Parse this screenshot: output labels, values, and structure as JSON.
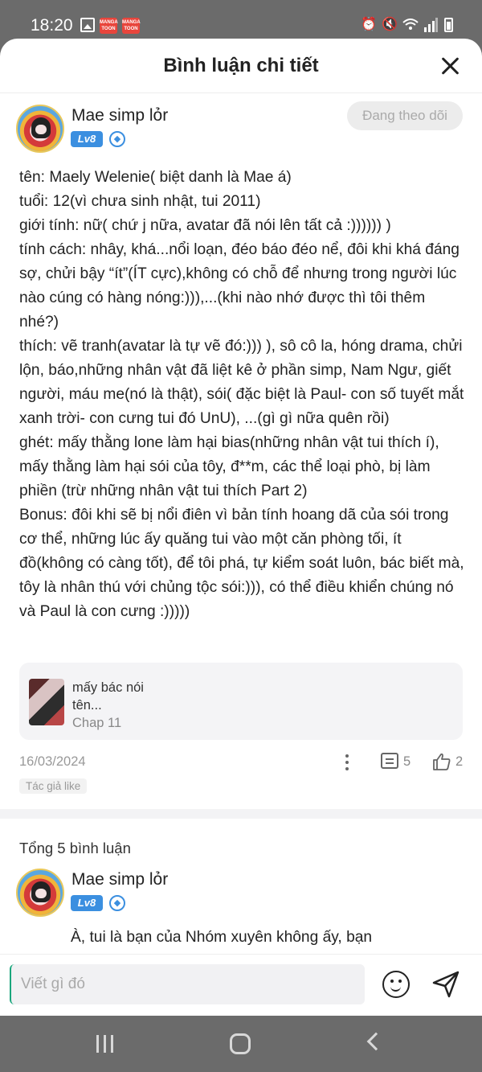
{
  "status_bar": {
    "time": "18:20",
    "left_icons": [
      "image-icon",
      "mangatoon-icon",
      "mangatoon-icon"
    ],
    "right_icons": [
      "alarm-icon",
      "mute-icon",
      "wifi-icon",
      "signal-icon",
      "battery-icon"
    ],
    "manga_badge": "MANGA TOON"
  },
  "sheet": {
    "title": "Bình luận chi tiết"
  },
  "comment": {
    "author": "Mae simp lỏr",
    "level": "Lv8",
    "follow_label": "Đang theo dõi",
    "body": "tên: Maely Welenie( biệt danh là Mae á)\ntuổi: 12(vì chưa sinh nhật, tui 2011)\ngiới tính: nữ( chứ j nữa, avatar đã nói lên tất cả :)))))) )\ntính cách: nhây, khá...nổi loạn, đéo báo đéo nể, đôi khi khá đáng sợ, chửi bậy “ít”(ÍT cực),không có chỗ để nhưng trong người lúc nào cúng có hàng nóng:))),...(khi nào nhớ được thì tôi thêm nhé?)\nthích: vẽ tranh(avatar là tự vẽ đó:))) ), sô cô la, hóng drama, chửi lộn, báo,những nhân vật đã liệt kê ở phần simp, Nam Ngư, giết người, máu me(nó là thật), sói( đặc biệt là Paul- con số tuyết mắt xanh trời- con cưng tui đó UnU), ...(gì gì nữa quên rồi)\nghét: mấy thằng lone làm hại bias(những nhân vật tui thích í), mấy thằng làm hại sói của tôy, đ**m, các thể loại phò, bị làm phiền (trừ những nhân vật tui thích Part 2)\nBonus: đôi khi sẽ bị nổi điên vì bản tính hoang dã của sói trong cơ thể, những lúc ấy quăng tui vào một căn phòng tối, ít đồ(không có càng tốt), để tôi phá, tự kiểm soát luôn, bác biết mà, tôy là nhân thú với chủng tộc sói:))), có thể điều khiển chúng nó và Paul là con cưng :)))))",
    "chapter_card": {
      "text_line1": "mấy bác nói",
      "text_line2": "tên...",
      "chapter": "Chap 11"
    },
    "date": "16/03/2024",
    "reply_count": "5",
    "like_count": "2",
    "author_like": "Tác giả like"
  },
  "replies": {
    "total": "Tổng 5 bình luận",
    "first": {
      "author": "Mae simp lỏr",
      "level": "Lv8",
      "text": "À, tui là bạn của Nhóm xuyên không ấy, bạn"
    }
  },
  "input": {
    "placeholder": "Viết gì đó"
  },
  "colors": {
    "level_badge": "#3b8fe0",
    "follow_bg": "#ececec",
    "system_bar": "#6b6b6b"
  }
}
